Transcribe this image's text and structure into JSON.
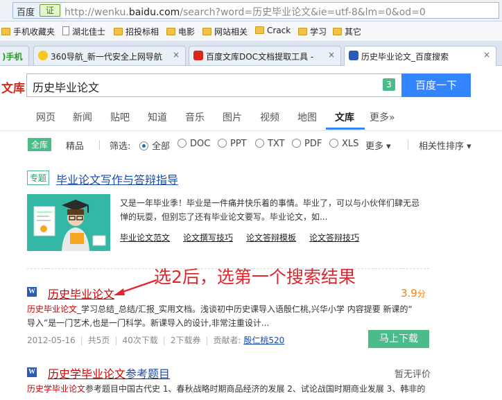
{
  "browser": {
    "identity_label": "百度",
    "cert_badge": "证",
    "url_prefix": "http://wenku.",
    "url_domain": "baidu.com",
    "url_suffix": "/search?word=历史毕业论文&ie=utf-8&lm=0&od=0"
  },
  "bookmarks": [
    {
      "label": "手机收藏夹",
      "icon": "folder-icon"
    },
    {
      "label": "湖北佳士",
      "icon": "page-icon"
    },
    {
      "label": "招投标相",
      "icon": "folder-icon"
    },
    {
      "label": "电影",
      "icon": "folder-icon"
    },
    {
      "label": "网站相关",
      "icon": "folder-icon"
    },
    {
      "label": "Crack",
      "icon": "folder-icon"
    },
    {
      "label": "学习",
      "icon": "folder-icon"
    },
    {
      "label": "其它",
      "icon": "folder-icon"
    }
  ],
  "tabs": [
    {
      "label": ")手机"
    },
    {
      "label": "360导航_新一代安全上网导航",
      "close": "×"
    },
    {
      "label": "百度文库DOC文档提取工具 -",
      "close": "×"
    },
    {
      "label": "历史毕业论文_百度搜索",
      "close": "×"
    }
  ],
  "wenku": {
    "logo": "文库",
    "query": "历史毕业论文",
    "count_badge": "3",
    "search_button": "百度一下"
  },
  "nav": [
    "网页",
    "新闻",
    "贴吧",
    "知道",
    "音乐",
    "图片",
    "视频",
    "地图",
    "文库",
    "更多»"
  ],
  "filters": {
    "scope_all": "全库",
    "scope_fine": "精品",
    "label": "筛选:",
    "options": [
      "全部",
      "DOC",
      "PPT",
      "TXT",
      "PDF",
      "XLS"
    ],
    "selected": "全部",
    "more": "更多",
    "sort": "相关性排序"
  },
  "topic": {
    "tag": "专题",
    "title": "毕业论文写作与答辩指导",
    "desc": "又是一年毕业季！毕业是一件痛并快乐着的事情。毕业了，可以与小伙伴们肆无忌惮的玩耍，但别忘了还有毕业论文要写。毕业论文，如...",
    "links": [
      "毕业论文范文",
      "论文撰写技巧",
      "论文答辩模板",
      "论文答辩技巧"
    ]
  },
  "annotation": "选2后，选第一个搜索结果",
  "results": [
    {
      "type_icon": "W",
      "title_hl": "历史毕业论文",
      "title_rest": "",
      "score_value": "3.9",
      "score_unit": "分",
      "desc_hl": "历史毕业论文",
      "desc_line1_rest": "_学习总结_总结/汇报_实用文档。浅谈初中历史课导入语殷仁桃,兴华小学 内容提要 新课的“",
      "desc_line2": "导入”是一门艺术,也是一门科学。新课导入的设计,非常注重设计...",
      "date": "2012-05-16",
      "pages": "共5页",
      "downloads": "40次下载",
      "coupons": "2下载券",
      "contributor_label": "贡献者:",
      "contributor": "殷仁桃520",
      "download_button": "马上下载"
    },
    {
      "type_icon": "W",
      "title_hl": "历史学毕业论文",
      "title_rest": "参考题目",
      "score_text": "暂无评价",
      "desc_hl": "历史学毕业论文",
      "desc_line1_rest": "参考题目中国古代史 1、春秋战略时期商品经济的发展 2、试论战国时期商业发展 3、韩非的"
    }
  ],
  "colors": {
    "accent_blue": "#3385ff",
    "accent_green": "#4cbb8a",
    "highlight_red": "#cc0000",
    "annotation_red": "#e0262e"
  }
}
